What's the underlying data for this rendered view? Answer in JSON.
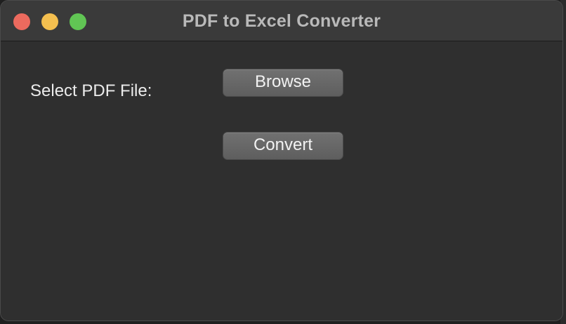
{
  "window": {
    "title": "PDF to Excel Converter"
  },
  "form": {
    "select_label": "Select PDF File:",
    "browse_label": "Browse",
    "convert_label": "Convert"
  },
  "colors": {
    "background": "#2f2f2f",
    "titlebar": "#3a3a3a",
    "button": "#686868",
    "close": "#ec6a5e",
    "minimize": "#f4bf4f",
    "zoom": "#61c554",
    "text": "#ececec"
  }
}
